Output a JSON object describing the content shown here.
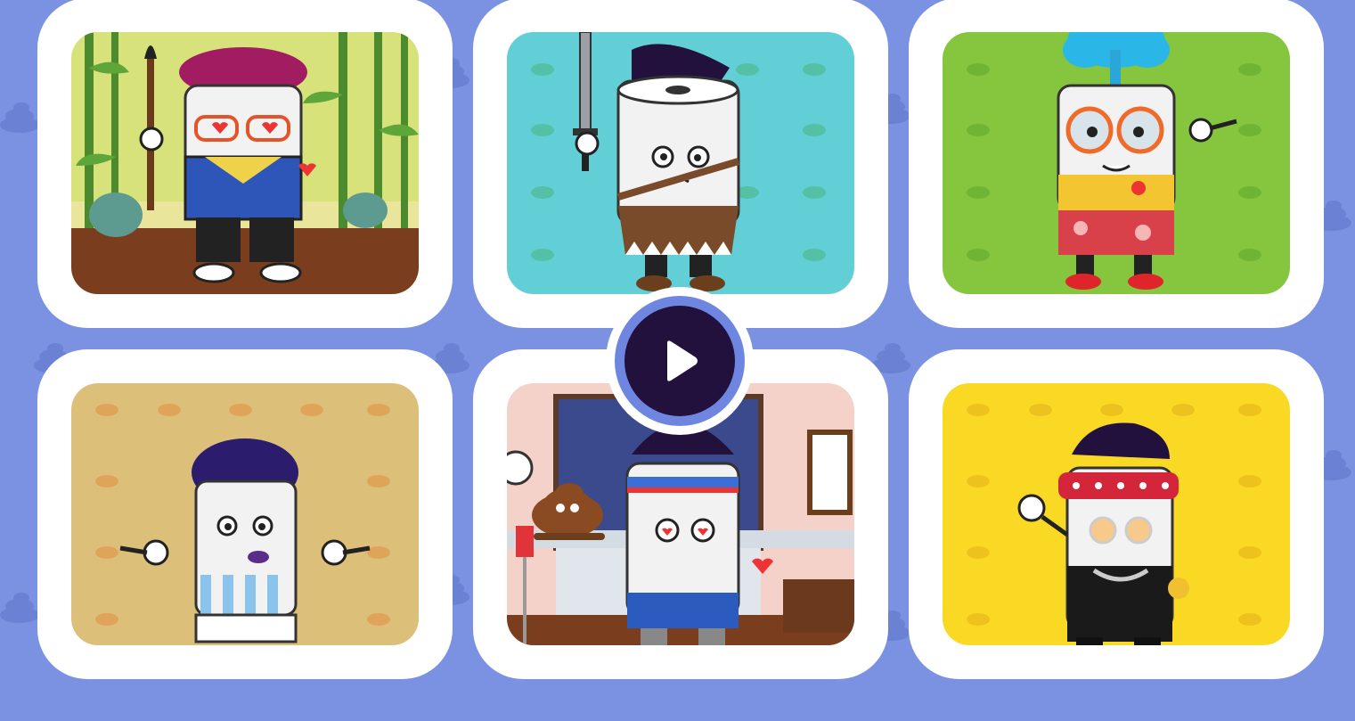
{
  "colors": {
    "background": "#7b92e3",
    "card": "#ffffff",
    "play_core": "#22113d",
    "play_ring": "#6f86e0"
  },
  "cards": [
    {
      "name": "artist-roll",
      "scene": "bamboo-forest",
      "bg": "#c7d95a"
    },
    {
      "name": "warrior-roll",
      "scene": "teal-pattern",
      "bg": "#62cfd6"
    },
    {
      "name": "tourist-roll",
      "scene": "green-pattern",
      "bg": "#86c63f"
    },
    {
      "name": "referee-roll",
      "scene": "tan-pattern",
      "bg": "#dcc07a"
    },
    {
      "name": "lover-roll",
      "scene": "living-room",
      "bg": "#f5d2c9"
    },
    {
      "name": "gangster-roll",
      "scene": "yellow-pattern",
      "bg": "#fad924"
    }
  ],
  "play_button": {
    "icon": "play-icon"
  }
}
